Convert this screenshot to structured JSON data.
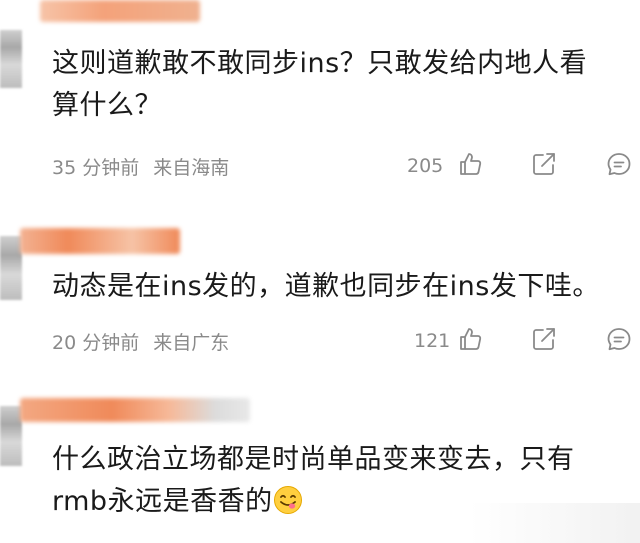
{
  "comments": [
    {
      "text_line1": "这则道歉敢不敢同步ins？只敢发给内地人看",
      "text_line2": "算什么？",
      "time": "35 分钟前",
      "location": "来自海南",
      "likes": "205"
    },
    {
      "text_line1": "动态是在ins发的，道歉也同步在ins发下哇。",
      "time": "20 分钟前",
      "location": "来自广东",
      "likes": "121"
    },
    {
      "text_line1": "什么政治立场都是时尚单品变来变去，只有",
      "text_line2": "rmb永远是香香的"
    }
  ],
  "icons": {
    "like": "thumbs-up-icon",
    "share": "share-icon",
    "reply": "comment-icon",
    "emoji": "yum-face-emoji-icon"
  },
  "colors": {
    "username_blur": "#f4a27a",
    "text": "#1a1a1a",
    "meta": "#8a8a8a"
  }
}
